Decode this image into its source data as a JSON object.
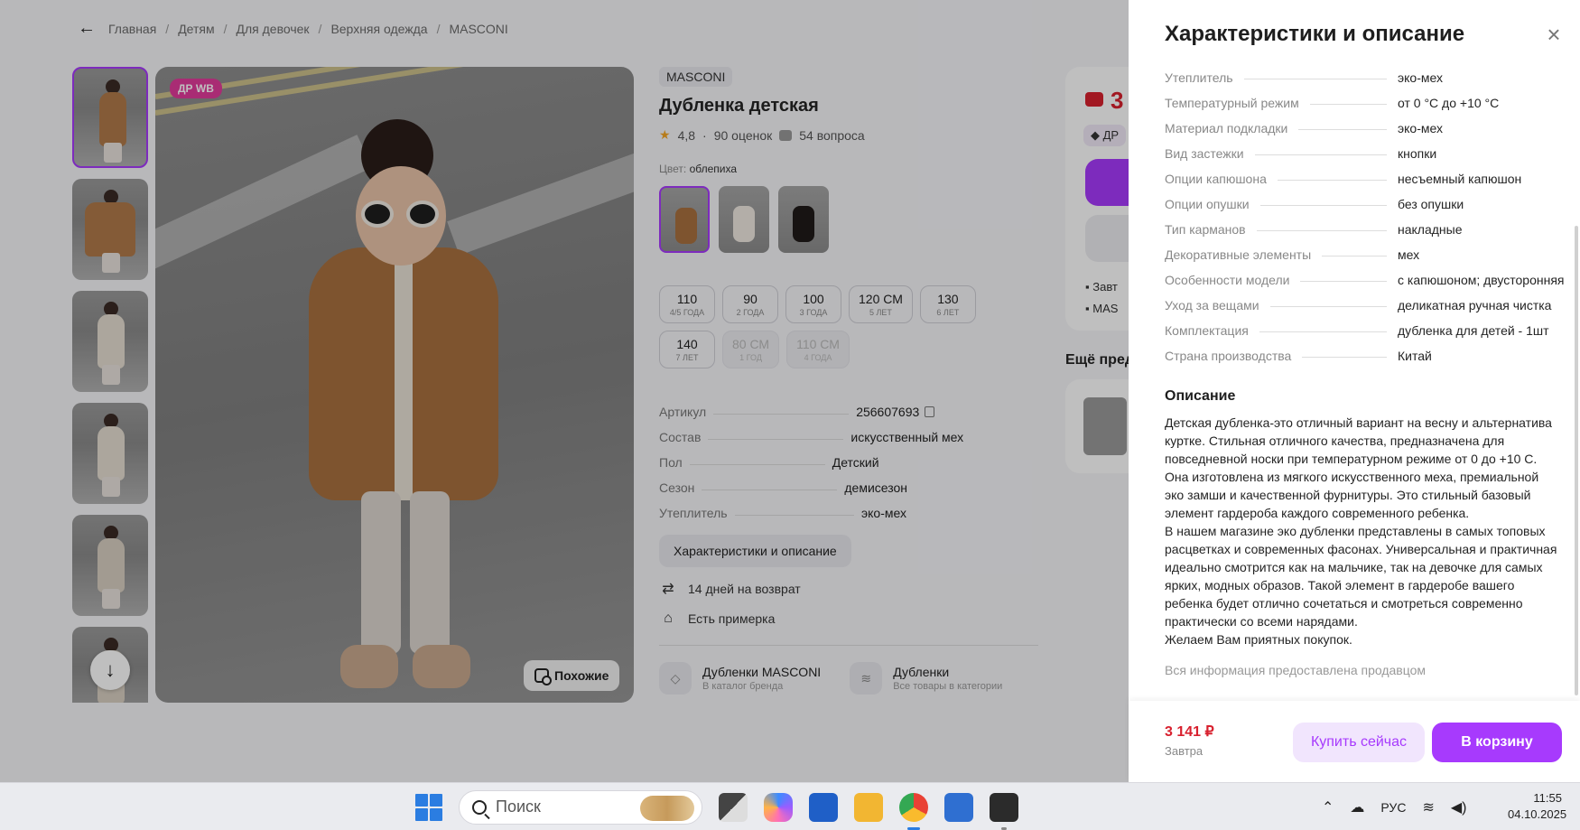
{
  "breadcrumbs": [
    "Главная",
    "Детям",
    "Для девочек",
    "Верхняя одежда",
    "MASCONI"
  ],
  "gallery": {
    "badge": "ДР WB",
    "similar_label": "Похожие"
  },
  "product": {
    "brand": "MASCONI",
    "title": "Дубленка детская",
    "rating": "4,8",
    "reviews": "90 оценок",
    "questions": "54 вопроса",
    "color_label": "Цвет:",
    "color_value": "облепиха",
    "sizes": [
      {
        "v": "110",
        "s": "4/5 ГОДА",
        "available": true
      },
      {
        "v": "90",
        "s": "2 ГОДА",
        "available": true
      },
      {
        "v": "100",
        "s": "3 ГОДА",
        "available": true
      },
      {
        "v": "120 СМ",
        "s": "5 ЛЕТ",
        "available": true
      },
      {
        "v": "130",
        "s": "6 ЛЕТ",
        "available": true
      },
      {
        "v": "140",
        "s": "7 ЛЕТ",
        "available": true
      },
      {
        "v": "80 СМ",
        "s": "1 ГОД",
        "available": false
      },
      {
        "v": "110 СМ",
        "s": "4 ГОДА",
        "available": false
      }
    ],
    "specs": [
      {
        "k": "Артикул",
        "v": "256607693"
      },
      {
        "k": "Состав",
        "v": "искусственный мех"
      },
      {
        "k": "Пол",
        "v": "Детский"
      },
      {
        "k": "Сезон",
        "v": "демисезон"
      },
      {
        "k": "Утеплитель",
        "v": "эко-мех"
      }
    ],
    "chars_button": "Характеристики и описание",
    "perks": [
      "14 дней на возврат",
      "Есть примерка"
    ],
    "links": [
      {
        "title": "Дубленки MASCONI",
        "sub": "В каталог бренда"
      },
      {
        "title": "Дубленки",
        "sub": "Все товары в категории"
      }
    ]
  },
  "buy_card": {
    "price_partial": "3",
    "dr_partial": "ДР",
    "delivery_1": "Завт",
    "delivery_2": "MAS"
  },
  "more_title": "Ещё пред",
  "panel": {
    "title": "Характеристики и описание",
    "characteristics": [
      {
        "k": "Утеплитель",
        "v": "эко-мех"
      },
      {
        "k": "Температурный режим",
        "v": "от 0 °С до +10 °С"
      },
      {
        "k": "Материал подкладки",
        "v": "эко-мех"
      },
      {
        "k": "Вид застежки",
        "v": "кнопки"
      },
      {
        "k": "Опции капюшона",
        "v": "несъемный капюшон"
      },
      {
        "k": "Опции опушки",
        "v": "без опушки"
      },
      {
        "k": "Тип карманов",
        "v": "накладные"
      },
      {
        "k": "Декоративные элементы",
        "v": "мех"
      },
      {
        "k": "Особенности модели",
        "v": "с капюшоном; двусторонняя"
      },
      {
        "k": "Уход за вещами",
        "v": "деликатная ручная чистка"
      },
      {
        "k": "Комплектация",
        "v": "дубленка для детей - 1шт"
      },
      {
        "k": "Страна производства",
        "v": "Китай"
      }
    ],
    "description_title": "Описание",
    "description": [
      "Детская дубленка-это отличный вариант на весну и альтернатива куртке. Стильная отличного качества, предназначена для повседневной носки при температурном режиме от 0 до +10 С. Она изготовлена из мягкого искусственного меха, премиальной эко замши и качественной фурнитуры. Это стильный базовый элемент гардероба каждого современного ребенка.",
      "В нашем магазине эко дубленки представлены в самых топовых расцветках и современных фасонах. Универсальная и практичная идеально смотрится как на мальчике, так на девочке для самых ярких, модных образов. Такой элемент в гардеробе вашего ребенка будет отлично сочетаться и смотреться современно практически со всеми нарядами.",
      "Желаем Вам приятных покупок."
    ],
    "seller_note": "Вся информация предоставлена продавцом",
    "footer": {
      "price": "3 141 ₽",
      "when": "Завтра",
      "buy_now": "Купить сейчас",
      "to_cart": "В корзину"
    }
  },
  "taskbar": {
    "search_placeholder": "Поиск",
    "lang": "РУС",
    "time": "11:55",
    "date": "04.10.2025"
  },
  "colors": {
    "accent": "#a73afd",
    "price": "#d8202e",
    "badge": "#e23b9b"
  }
}
